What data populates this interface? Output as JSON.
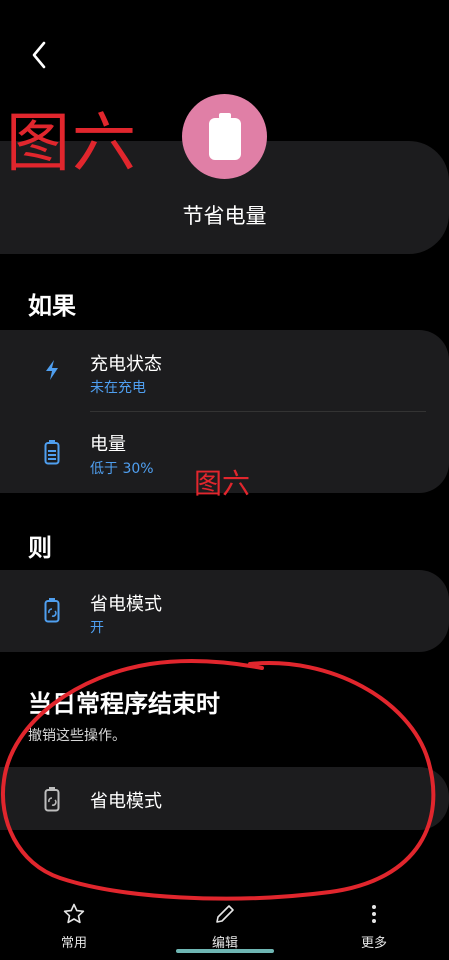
{
  "watermark_text": "图六",
  "routine": {
    "name": "节省电量",
    "icon": "battery-icon",
    "icon_color": "#e07fa6"
  },
  "if_section": {
    "title": "如果",
    "conditions": [
      {
        "title": "充电状态",
        "value": "未在充电",
        "icon": "lightning-icon"
      },
      {
        "title": "电量",
        "value": "低于 30%",
        "icon": "battery-level-icon"
      }
    ]
  },
  "then_section": {
    "title": "则",
    "actions": [
      {
        "title": "省电模式",
        "value": "开",
        "icon": "battery-saver-icon"
      }
    ]
  },
  "end_section": {
    "title": "当日常程序结束时",
    "description": "撤销这些操作。",
    "actions": [
      {
        "title": "省电模式",
        "icon": "battery-saver-icon"
      }
    ]
  },
  "bottom_nav": {
    "items": [
      {
        "label": "常用",
        "icon": "star-icon"
      },
      {
        "label": "编辑",
        "icon": "pencil-icon"
      },
      {
        "label": "更多",
        "icon": "more-vertical-icon"
      }
    ]
  },
  "colors": {
    "accent": "#4f9ff0",
    "card": "#1c1c1e",
    "annotation": "#e1262d"
  }
}
